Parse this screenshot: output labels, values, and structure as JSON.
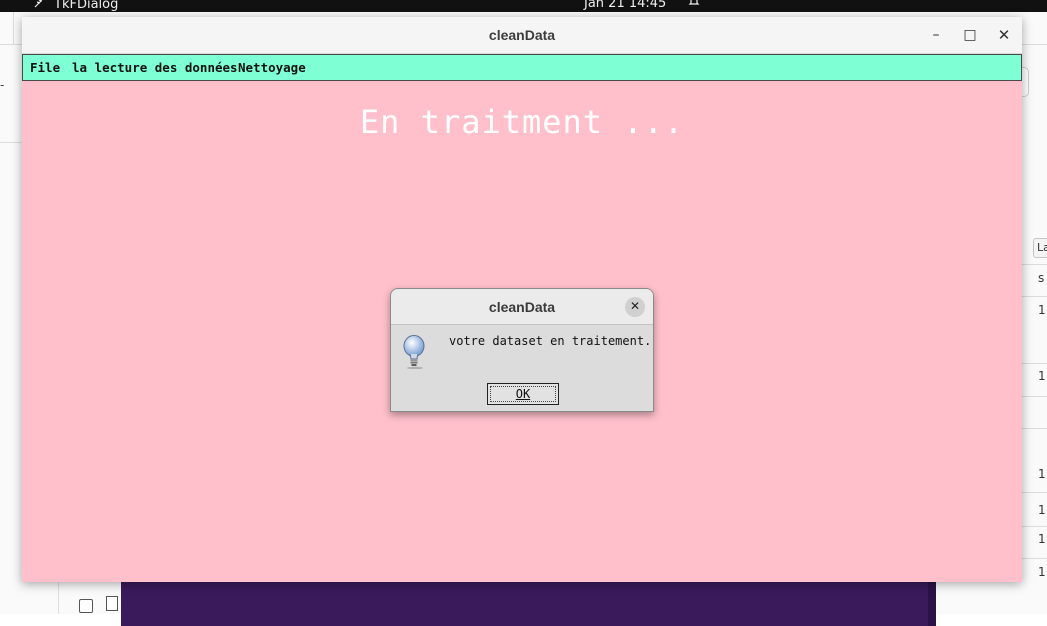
{
  "system_bar": {
    "app_name": "TkFDialog",
    "app_icon": "tk-feather-icon",
    "datetime": "Jan 21  14:45",
    "bell_icon": "bell-icon"
  },
  "background_app": {
    "corner_label": "La",
    "right_values": [
      "s",
      "1",
      "1",
      "1",
      "1",
      "1",
      "1"
    ]
  },
  "window": {
    "title": "cleanData",
    "controls": {
      "minimize": "–",
      "maximize": "□",
      "close": "✕"
    },
    "menu": [
      "File",
      "la lecture des données",
      "Nettoyage"
    ],
    "heading": "En traitment ...",
    "colors": {
      "background": "#ffc0cb",
      "menubar": "#7fffd4",
      "heading": "#ffffff"
    }
  },
  "dialog": {
    "title": "cleanData",
    "close": "✕",
    "icon": "lightbulb-info-icon",
    "message": "votre dataset en traitement.",
    "ok_label": "OK"
  }
}
